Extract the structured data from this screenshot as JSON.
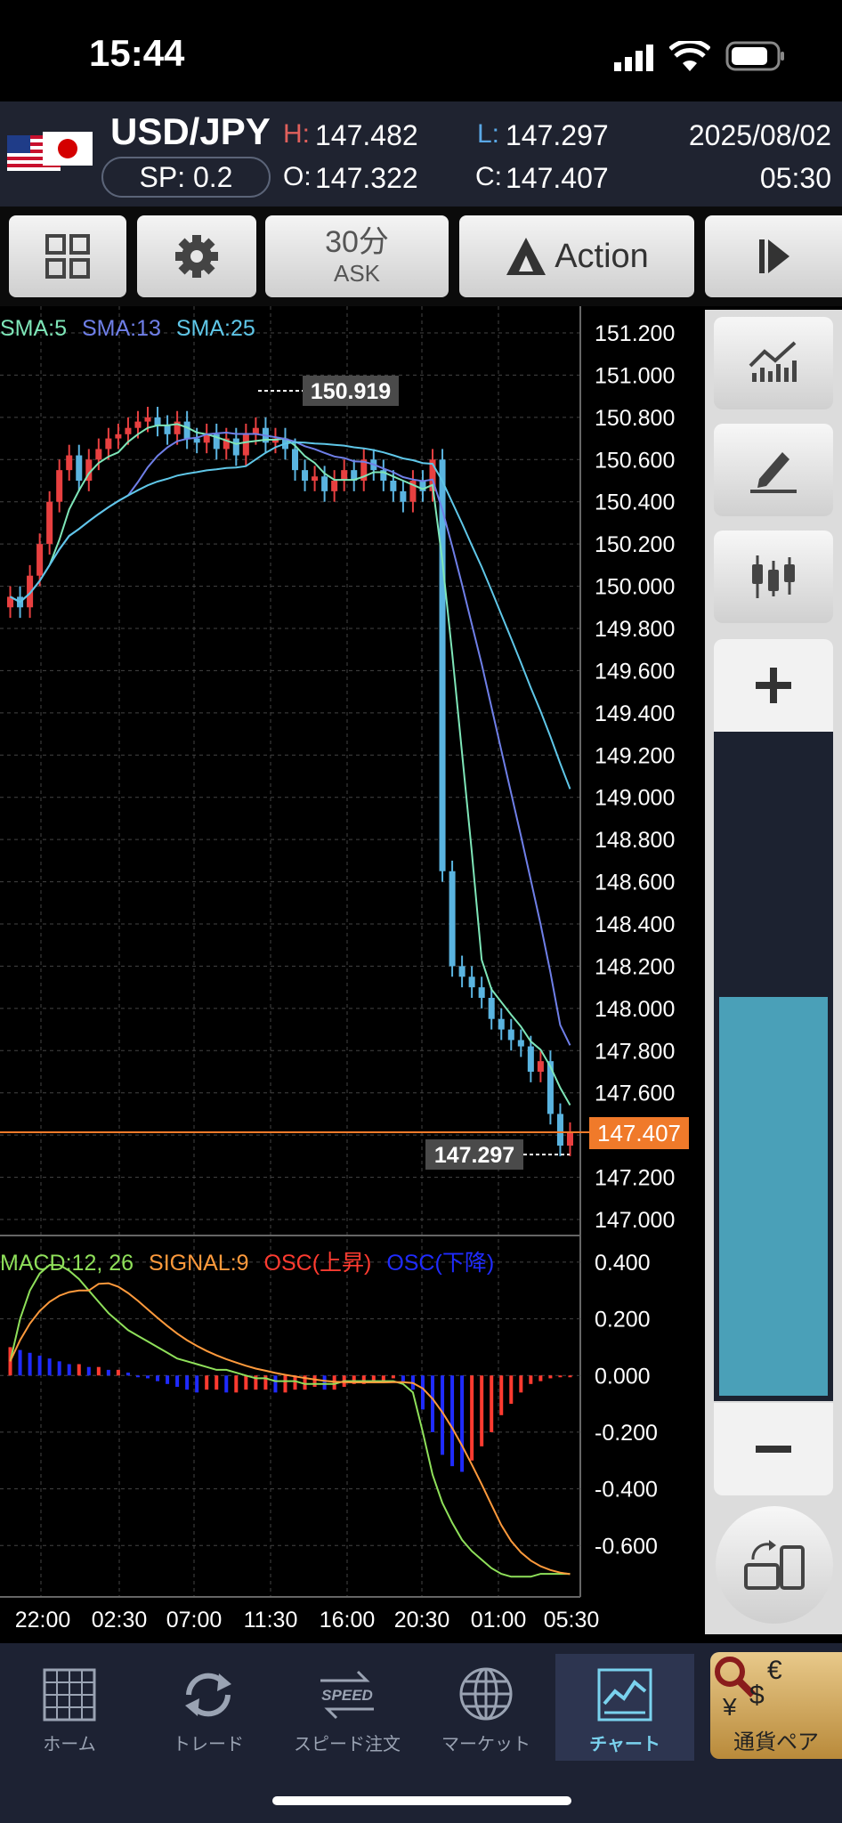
{
  "status": {
    "time": "15:44"
  },
  "quote": {
    "pair": "USD/JPY",
    "spread": "SP: 0.2",
    "high_label": "H:",
    "high": "147.482",
    "low_label": "L:",
    "low": "147.297",
    "open_label": "O:",
    "open": "147.322",
    "close_label": "C:",
    "close": "147.407",
    "date": "2025/08/02",
    "time": "05:30"
  },
  "toolbar": {
    "timeframe": "30分",
    "price_type": "ASK",
    "action_label": "Action"
  },
  "chart": {
    "sma_labels": [
      "SMA:5",
      "SMA:13",
      "SMA:25"
    ],
    "sma_colors": [
      "#7ee6b8",
      "#6f7fe8",
      "#5fc7e8"
    ],
    "macd_labels": [
      "MACD:12, 26",
      "SIGNAL:9",
      "OSC(上昇)",
      "OSC(下降)"
    ],
    "macd_colors": [
      "#8fe05a",
      "#ff9a3c",
      "#ff3b30",
      "#1f2bff"
    ],
    "high_marker": "150.919",
    "low_marker": "147.297",
    "current_price": "147.407",
    "x_ticks": [
      "22:00",
      "02:30",
      "07:00",
      "11:30",
      "16:00",
      "20:30",
      "01:00",
      "05:30"
    ]
  },
  "chart_data": [
    {
      "type": "candlestick",
      "ylim": [
        147.0,
        151.2
      ],
      "y_ticks": [
        "151.200",
        "151.000",
        "150.800",
        "150.600",
        "150.400",
        "150.200",
        "150.000",
        "149.800",
        "149.600",
        "149.400",
        "149.200",
        "149.000",
        "148.800",
        "148.600",
        "148.400",
        "148.200",
        "148.000",
        "147.800",
        "147.600",
        "147.400",
        "147.200",
        "147.000"
      ],
      "legend": [
        "SMA:5",
        "SMA:13",
        "SMA:25"
      ],
      "close_series": [
        149.95,
        149.9,
        150.05,
        150.2,
        150.4,
        150.55,
        150.62,
        150.5,
        150.6,
        150.65,
        150.7,
        150.72,
        150.75,
        150.78,
        150.8,
        150.76,
        150.72,
        150.78,
        150.7,
        150.68,
        150.72,
        150.65,
        150.7,
        150.62,
        150.72,
        150.75,
        150.68,
        150.7,
        150.65,
        150.55,
        150.5,
        150.52,
        150.45,
        150.5,
        150.55,
        150.5,
        150.6,
        150.55,
        150.5,
        150.45,
        150.4,
        150.5,
        150.45,
        150.6,
        148.65,
        148.2,
        148.15,
        148.1,
        148.05,
        147.95,
        147.9,
        147.85,
        147.82,
        147.7,
        147.75,
        147.5,
        147.35,
        147.41
      ],
      "sma5_end": 147.6,
      "sma13_end": 147.8,
      "sma25_end": 148.75,
      "high": 150.919,
      "low": 147.297,
      "last": 147.407
    },
    {
      "type": "bar",
      "title": "MACD",
      "ylim": [
        -0.75,
        0.45
      ],
      "y_ticks": [
        "0.400",
        "0.200",
        "0.000",
        "-0.200",
        "-0.400",
        "-0.600"
      ],
      "legend": [
        "MACD:12, 26",
        "SIGNAL:9",
        "OSC(上昇)",
        "OSC(下降)"
      ],
      "osc_values": [
        0.1,
        0.09,
        0.08,
        0.07,
        0.06,
        0.05,
        0.04,
        0.04,
        0.03,
        0.03,
        0.02,
        0.02,
        0.01,
        0.0,
        -0.01,
        -0.02,
        -0.03,
        -0.04,
        -0.05,
        -0.06,
        -0.05,
        -0.05,
        -0.06,
        -0.06,
        -0.05,
        -0.05,
        -0.05,
        -0.06,
        -0.06,
        -0.05,
        -0.05,
        -0.04,
        -0.05,
        -0.05,
        -0.04,
        -0.03,
        -0.03,
        -0.02,
        -0.02,
        -0.01,
        -0.02,
        -0.05,
        -0.12,
        -0.2,
        -0.28,
        -0.32,
        -0.34,
        -0.3,
        -0.25,
        -0.2,
        -0.14,
        -0.1,
        -0.06,
        -0.03,
        -0.02,
        -0.01,
        0.0,
        0.0
      ],
      "macd_end": -0.7,
      "signal_end": -0.69
    }
  ],
  "panel": {},
  "nav": [
    {
      "label": "ホーム"
    },
    {
      "label": "トレード"
    },
    {
      "label": "スピード注文",
      "icon_text": "SPEED"
    },
    {
      "label": "マーケット"
    },
    {
      "label": "チャート"
    },
    {
      "label": "通貨ペア",
      "icon_text_1": "€",
      "icon_text_2": "$",
      "icon_text_3": "¥"
    }
  ]
}
